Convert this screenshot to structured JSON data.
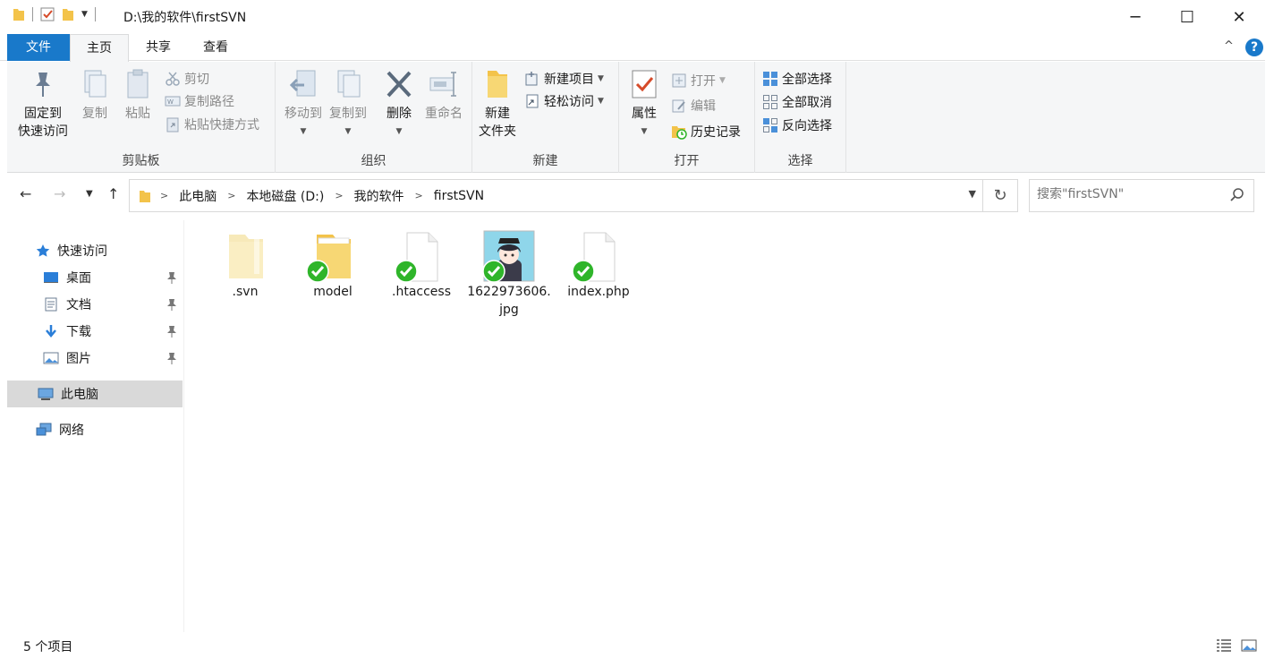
{
  "titlebar": {
    "path": "D:\\我的软件\\firstSVN",
    "minimize": "─",
    "maximize": "☐",
    "close": "✕"
  },
  "tabs": {
    "file": "文件",
    "home": "主页",
    "share": "共享",
    "view": "查看",
    "collapse": "^",
    "help": "?"
  },
  "ribbon": {
    "clipboard": {
      "pin_line1": "固定到",
      "pin_line2": "快速访问",
      "copy": "复制",
      "paste": "粘贴",
      "cut": "剪切",
      "copy_path": "复制路径",
      "paste_shortcut": "粘贴快捷方式",
      "label": "剪贴板"
    },
    "organize": {
      "move_to": "移动到",
      "copy_to": "复制到",
      "delete": "删除",
      "rename": "重命名",
      "label": "组织"
    },
    "new": {
      "new_folder_line1": "新建",
      "new_folder_line2": "文件夹",
      "new_item": "新建项目",
      "easy_access": "轻松访问",
      "label": "新建"
    },
    "open": {
      "properties": "属性",
      "open": "打开",
      "edit": "编辑",
      "history": "历史记录",
      "label": "打开"
    },
    "select": {
      "select_all": "全部选择",
      "select_none": "全部取消",
      "invert": "反向选择",
      "label": "选择"
    }
  },
  "address": {
    "crumbs": [
      "此电脑",
      "本地磁盘 (D:)",
      "我的软件",
      "firstSVN"
    ],
    "search_placeholder": "搜索\"firstSVN\""
  },
  "navpane": {
    "quick_access": "快速访问",
    "desktop": "桌面",
    "documents": "文档",
    "downloads": "下载",
    "pictures": "图片",
    "this_pc": "此电脑",
    "network": "网络"
  },
  "files": [
    {
      "name": ".svn",
      "type": "folder",
      "svn_status": "none"
    },
    {
      "name": "model",
      "type": "folder",
      "svn_status": "normal"
    },
    {
      "name": ".htaccess",
      "type": "file",
      "svn_status": "normal"
    },
    {
      "name": "1622973606.jpg",
      "type": "image",
      "svn_status": "normal"
    },
    {
      "name": "index.php",
      "type": "file",
      "svn_status": "normal"
    }
  ],
  "status": {
    "item_count": "5 个项目"
  },
  "colors": {
    "accent": "#1979ca",
    "ribbon_bg": "#f5f6f7",
    "svn_ok": "#2fb52a",
    "folder": "#f7d774"
  }
}
